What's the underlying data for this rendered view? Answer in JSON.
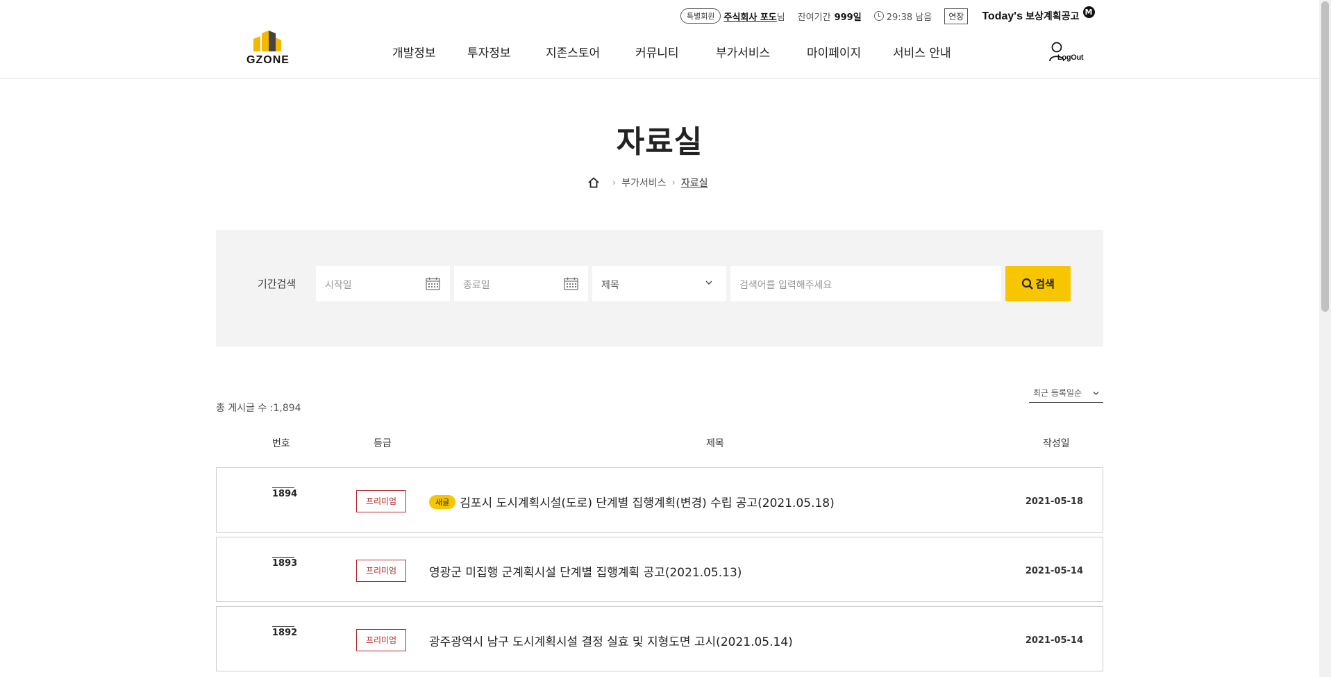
{
  "header": {
    "member_badge": "특별회원",
    "user_name": "주식회사 포도",
    "user_suffix": "님",
    "remain_label": "잔여기간",
    "remain_value": "999일",
    "time_left": "29:38 남음",
    "extend_label": "연장",
    "todays_label": "Today's",
    "todays_sub": "보상계획공고",
    "todays_badge": "M",
    "logo_text": "GZONE",
    "logout_label": "LogOut",
    "nav": [
      "개발정보",
      "투자정보",
      "지존스토어",
      "커뮤니티",
      "부가서비스",
      "마이페이지",
      "서비스 안내"
    ]
  },
  "page": {
    "title": "자료실",
    "breadcrumb": [
      "부가서비스",
      "자료실"
    ]
  },
  "search": {
    "label": "기간검색",
    "start_placeholder": "시작일",
    "end_placeholder": "종료일",
    "category_selected": "제목",
    "keyword_placeholder": "검색어를 입력해주세요",
    "button_label": "검색"
  },
  "list": {
    "total_label": "총 게시글 수 :1,894",
    "sort_label": "최근 등록일순",
    "columns": [
      "번호",
      "등급",
      "제목",
      "작성일"
    ],
    "rows": [
      {
        "num": "1894",
        "grade": "프리미엄",
        "new_badge": "새글",
        "title": "김포시 도시계획시설(도로) 단계별 집행계획(변경) 수립 공고(2021.05.18)",
        "date": "2021-05-18"
      },
      {
        "num": "1893",
        "grade": "프리미엄",
        "title": "영광군 미집행 군계획시설 단계별 집행계획 공고(2021.05.13)",
        "date": "2021-05-14"
      },
      {
        "num": "1892",
        "grade": "프리미엄",
        "title": "광주광역시 남구 도시계획시설 결정 실효 및 지형도면 고시(2021.05.14)",
        "date": "2021-05-14"
      }
    ]
  },
  "colors": {
    "accent": "#f7c600",
    "grade_red": "#b3282b",
    "search_bg": "#f3f3f3"
  }
}
